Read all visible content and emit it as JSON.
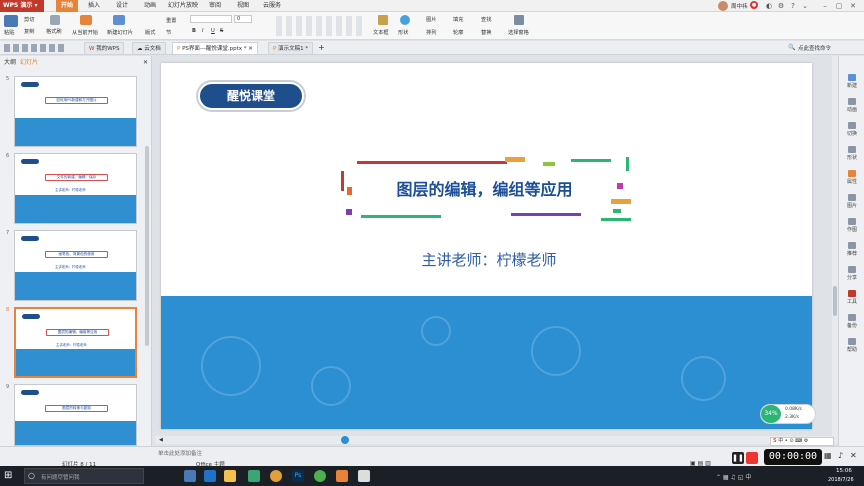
{
  "window": {
    "app_name": "WPS 演示",
    "user_name": "周中祎",
    "menu_tabs": [
      "开始",
      "插入",
      "设计",
      "动画",
      "幻灯片放映",
      "审阅",
      "视图",
      "云服务"
    ],
    "active_tab": "开始"
  },
  "ribbon": {
    "paste": "粘贴",
    "cut": "剪切",
    "copy": "复制",
    "format_painter": "格式刷",
    "from_current": "从当前开始",
    "new_slide": "新建幻灯片",
    "layout": "版式",
    "reset": "重置",
    "section": "节",
    "font_name": "",
    "font_size": "0",
    "bold": "B",
    "italic": "I",
    "underline": "U",
    "strike": "S",
    "text_box": "文本框",
    "shape": "形状",
    "arrange": "排列",
    "outline": "轮廓",
    "picture": "图片",
    "fill": "填充",
    "find": "查找",
    "replace": "替换",
    "select_pane": "选择窗格"
  },
  "doc_tabs": {
    "my_wps": "我的WPS",
    "cloud_doc": "云文档",
    "active_file": "PS界面---醒悦课堂.pptx *",
    "new_file": "演示文稿1 *",
    "right_text": "点此查找命令"
  },
  "left_panel": {
    "tab_outline": "大纲",
    "tab_slides": "幻灯片",
    "thumbs": [
      {
        "num": "5",
        "title": "如何用PS新建和打开图片",
        "sub": ""
      },
      {
        "num": "6",
        "title": "文件的新建、编辑、保存",
        "sub": "主讲老师：柠檬老师"
      },
      {
        "num": "7",
        "title": "画笔色、背景色的使用",
        "sub": "主讲老师：柠檬老师"
      },
      {
        "num": "8",
        "title": "图层的编辑，编组等应用",
        "sub": "主讲老师：柠檬老师"
      },
      {
        "num": "9",
        "title": "图层的转换与复制",
        "sub": ""
      }
    ],
    "add_button": "+"
  },
  "slide": {
    "badge": "醒悦课堂",
    "title": "图层的编辑，编组等应用",
    "speaker": "主讲老师：柠檬老师"
  },
  "right_sidebar": [
    "新建",
    "动画",
    "切换",
    "形状",
    "属性",
    "图片",
    "作图",
    "推荐",
    "分享",
    "工具",
    "备份",
    "帮助"
  ],
  "status": {
    "notes_placeholder": "单击此处添加备注",
    "slide_counter": "幻灯片 8 / 11",
    "theme": "Office 主题",
    "net_percent": "34%",
    "up_speed": "0.08K/s",
    "down_speed": "2.3K/s",
    "zoom": "-"
  },
  "recorder": {
    "timer": "00:00:00"
  },
  "taskbar": {
    "search_placeholder": "有问题尽管问我",
    "time": "15:06",
    "date": "2018/7/26"
  }
}
